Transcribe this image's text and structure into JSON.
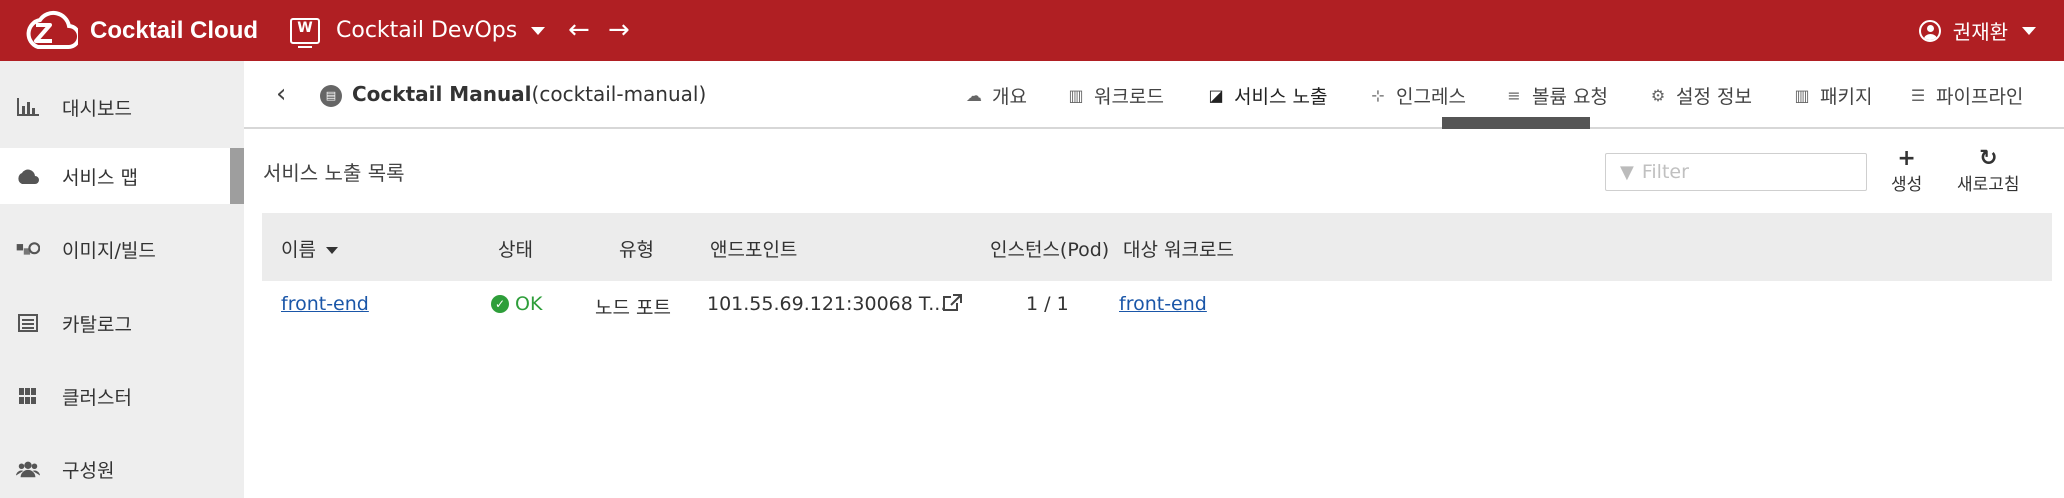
{
  "topbar": {
    "brand": "Cocktail Cloud",
    "project": "Cocktail DevOps",
    "project_icon_letter": "W",
    "back_arrow": "←",
    "forward_arrow": "→",
    "user": "권재환"
  },
  "sidebar": {
    "items": [
      {
        "label": "대시보드",
        "icon": "bar-chart-icon"
      },
      {
        "label": "서비스 맵",
        "icon": "cloud-icon",
        "active": true
      },
      {
        "label": "이미지/빌드",
        "icon": "cubes-icon"
      },
      {
        "label": "카탈로그",
        "icon": "list-alt-icon"
      },
      {
        "label": "클러스터",
        "icon": "grid-icon"
      },
      {
        "label": "구성원",
        "icon": "users-icon"
      }
    ]
  },
  "subheader": {
    "back_icon": "‹",
    "app_name": "Cocktail Manual",
    "app_id": "(cocktail-manual)",
    "tabs": [
      {
        "label": "개요",
        "icon": "cloud-icon"
      },
      {
        "label": "워크로드",
        "icon": "map-icon"
      },
      {
        "label": "서비스 노출",
        "icon": "external-link-icon",
        "active": true
      },
      {
        "label": "인그레스",
        "icon": "sitemap-icon"
      },
      {
        "label": "볼륨 요청",
        "icon": "database-icon"
      },
      {
        "label": "설정 정보",
        "icon": "gear-icon"
      },
      {
        "label": "패키지",
        "icon": "map-icon"
      },
      {
        "label": "파이프라인",
        "icon": "list-icon"
      }
    ]
  },
  "content": {
    "title": "서비스 노출 목록",
    "filter_placeholder": "Filter",
    "create_label": "생성",
    "refresh_label": "새로고침"
  },
  "table": {
    "headers": [
      "이름",
      "상태",
      "유형",
      "앤드포인트",
      "인스턴스(Pod)",
      "대상 워크로드"
    ],
    "rows": [
      {
        "name": "front-end",
        "status": "OK",
        "type": "노드 포트",
        "endpoint": "101.55.69.121:30068 T...",
        "instances": "1 / 1",
        "target_workload": "front-end"
      }
    ]
  },
  "colors": {
    "topbar": "#b01f23",
    "sidebar": "#eeeeee",
    "link": "#1a56a8",
    "ok": "#2e9e3a"
  }
}
